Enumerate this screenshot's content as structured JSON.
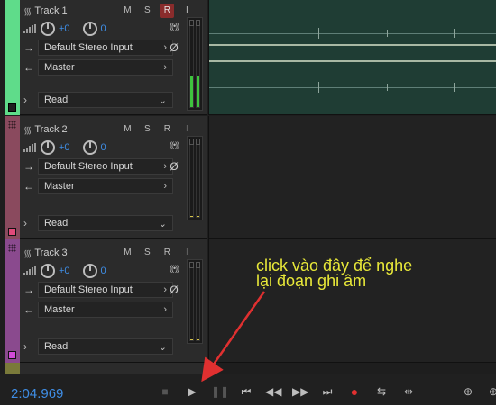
{
  "tracks": [
    {
      "name": "Track 1",
      "volume": "+0",
      "pan": "0",
      "input": "Default Stereo Input",
      "output": "Master",
      "automation": "Read",
      "buttons": {
        "mute": "M",
        "solo": "S",
        "record": "R",
        "input_monitor": "I"
      },
      "color": "#5fdc8a",
      "meter_level": 0.28,
      "record_armed": true
    },
    {
      "name": "Track 2",
      "volume": "+0",
      "pan": "0",
      "input": "Default Stereo Input",
      "output": "Master",
      "automation": "Read",
      "buttons": {
        "mute": "M",
        "solo": "S",
        "record": "R",
        "input_monitor": "I"
      },
      "color": "#8a4a5e",
      "meter_level": 0,
      "record_armed": false
    },
    {
      "name": "Track 3",
      "volume": "+0",
      "pan": "0",
      "input": "Default Stereo Input",
      "output": "Master",
      "automation": "Read",
      "buttons": {
        "mute": "M",
        "solo": "S",
        "record": "R",
        "input_monitor": "I"
      },
      "color": "#8a4a8e",
      "meter_level": 0,
      "record_armed": false
    }
  ],
  "transport": {
    "time": "2:04.969",
    "icons": [
      "stop-icon",
      "play-icon",
      "pause-icon",
      "go-to-start-icon",
      "rewind-icon",
      "fast-forward-icon",
      "go-to-end-icon",
      "record-icon",
      "loop-icon",
      "skip-selection-icon",
      "zoom-in-icon"
    ]
  },
  "annotation": {
    "text": "click vào đây để nghe lại đoạn ghi âm",
    "color": "#e8e839"
  },
  "colors": {
    "time_blue": "#3f8ee6",
    "record_red": "#e23030",
    "arm_red": "#8a2c2c",
    "meter_green": "#3ec43e"
  }
}
